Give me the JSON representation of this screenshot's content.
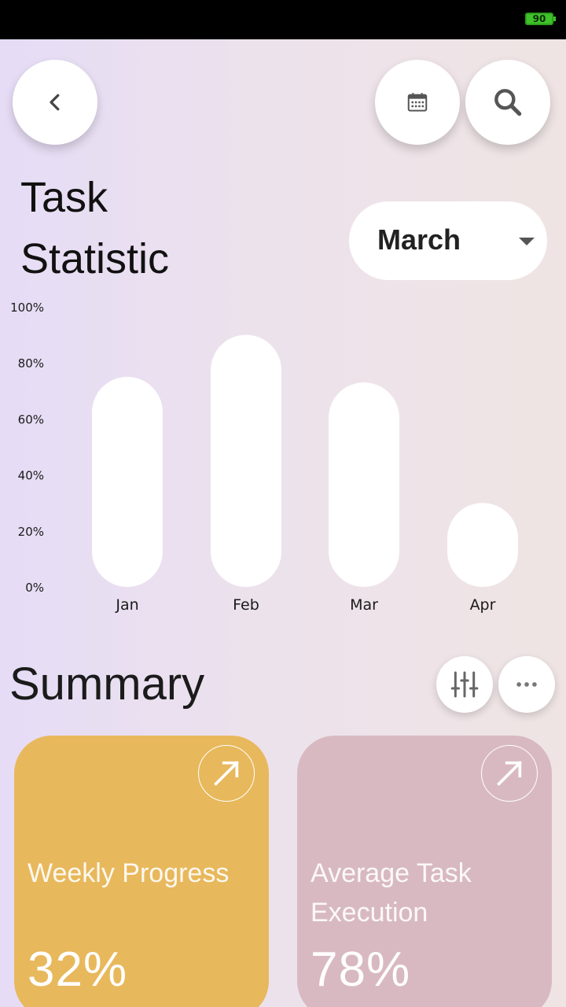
{
  "status_bar": {
    "battery": "90"
  },
  "header": {
    "back_icon": "chevron-left-icon",
    "calendar_icon": "calendar-icon",
    "search_icon": "search-icon"
  },
  "title": {
    "line1": "Task",
    "line2": "Statistic"
  },
  "month_select": {
    "value": "March"
  },
  "chart_data": {
    "type": "bar",
    "categories": [
      "Jan",
      "Feb",
      "Mar",
      "Apr"
    ],
    "values": [
      75,
      90,
      73,
      30
    ],
    "ylim": [
      0,
      100
    ],
    "y_ticks": [
      "0%",
      "20%",
      "40%",
      "60%",
      "80%",
      "100%"
    ],
    "bar_color": "#ffffff",
    "grid": false
  },
  "summary": {
    "title": "Summary",
    "filter_icon": "sliders-icon",
    "more_icon": "more-horizontal-icon",
    "cards": [
      {
        "label": "Weekly Progress",
        "value": "32%",
        "color": "#e8b85c",
        "icon": "arrow-up-right-icon"
      },
      {
        "label": "Average Task Execution",
        "value": "78%",
        "color": "#d8b9c2",
        "icon": "arrow-up-right-icon"
      }
    ]
  }
}
